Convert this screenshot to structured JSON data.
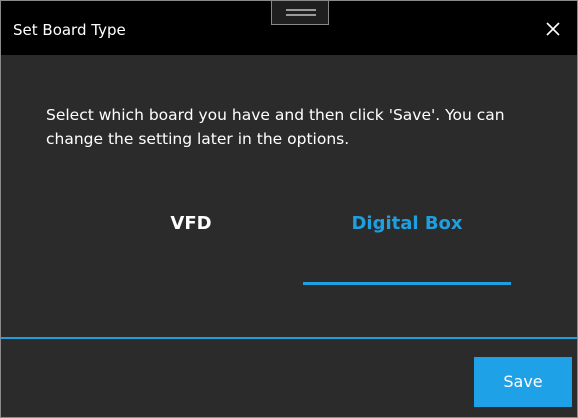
{
  "window": {
    "title": "Set Board Type",
    "close_icon": "close-icon",
    "accent_color": "#1e9fe0"
  },
  "content": {
    "message": "Select which board you have and then click 'Save'. You can change the setting later in the options."
  },
  "tabs": [
    {
      "label": "VFD",
      "selected": false
    },
    {
      "label": "Digital Box",
      "selected": true
    }
  ],
  "footer": {
    "save_label": "Save"
  }
}
